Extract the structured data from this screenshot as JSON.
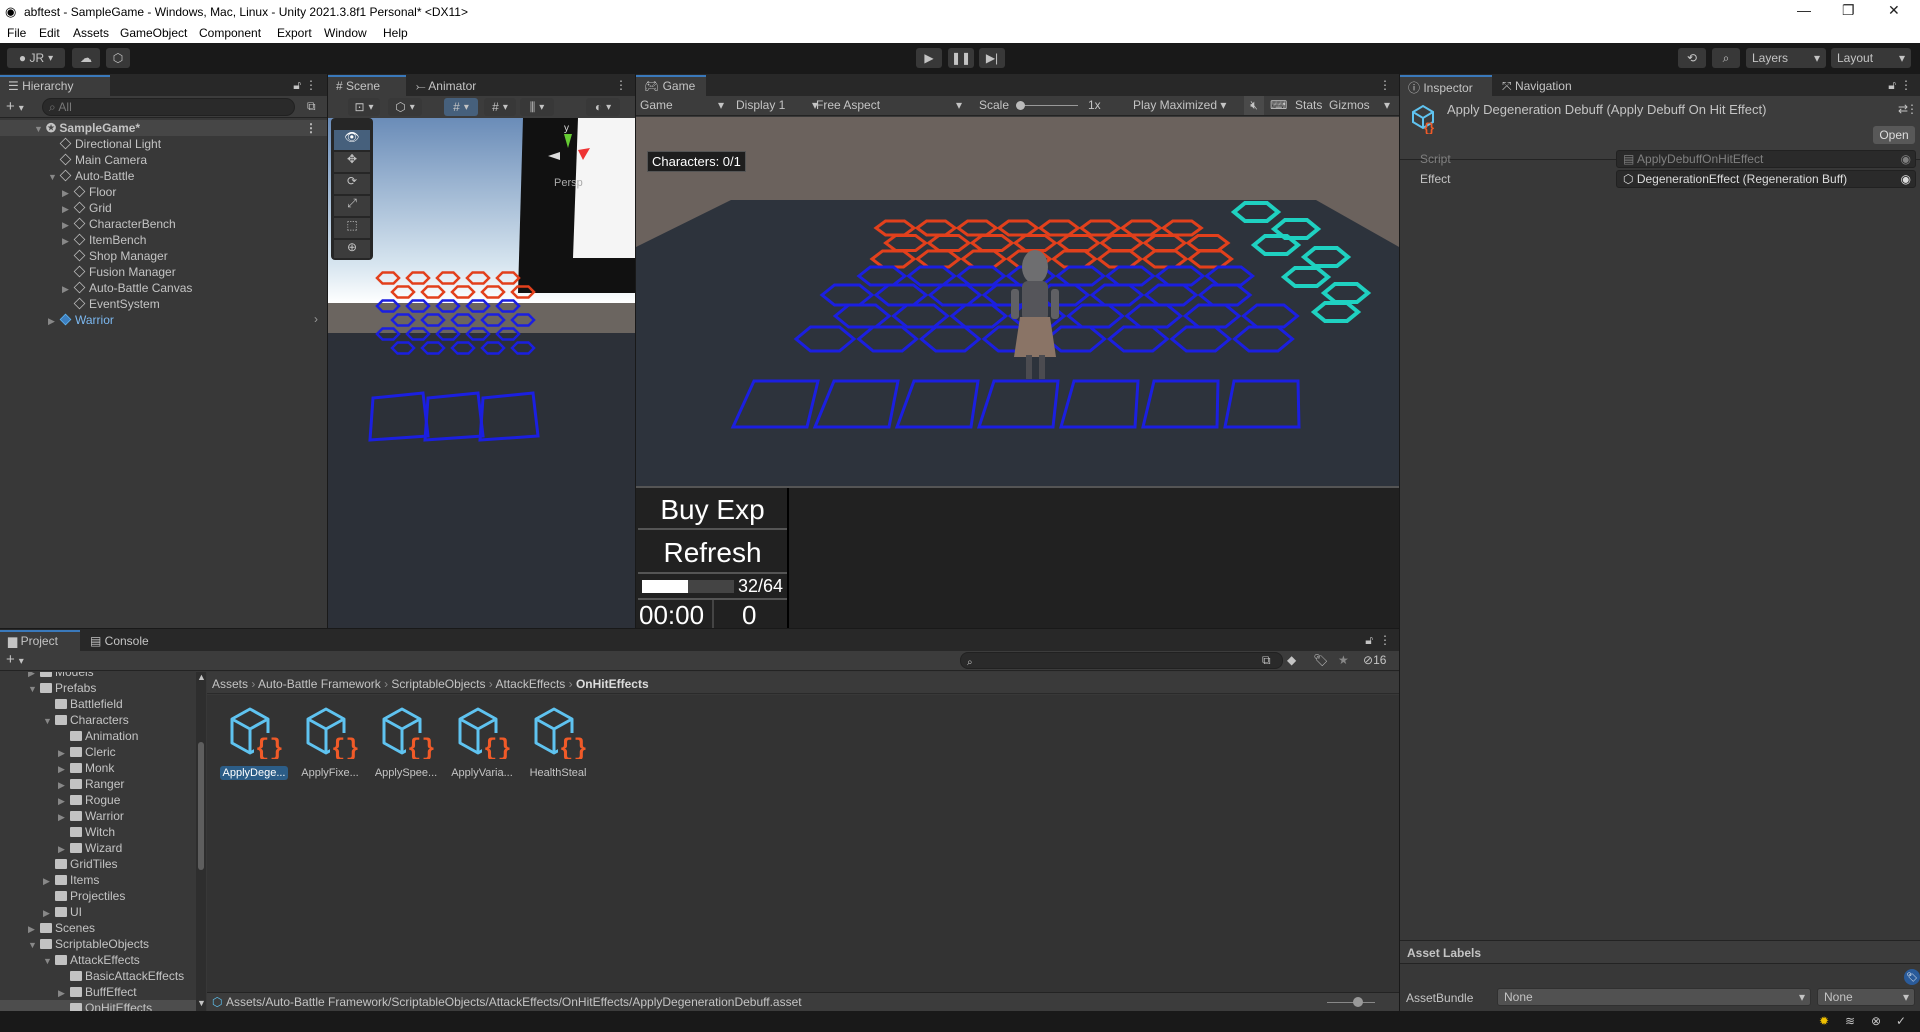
{
  "window": {
    "title": "abftest - SampleGame - Windows, Mac, Linux - Unity 2021.3.8f1 Personal* <DX11>",
    "minimize": "—",
    "maximize": "❐",
    "close": "✕"
  },
  "menu": [
    "File",
    "Edit",
    "Assets",
    "GameObject",
    "Component",
    "Export",
    "Window",
    "Help"
  ],
  "toolbar": {
    "account": "JR",
    "layers": "Layers",
    "layout": "Layout",
    "play_icon": "play-icon",
    "pause_icon": "pause-icon",
    "step_icon": "step-icon"
  },
  "hierarchy": {
    "tab": "Hierarchy",
    "search_placeholder": "All",
    "scene": "SampleGame*",
    "items": [
      {
        "label": "Directional Light",
        "depth": 1,
        "expander": ""
      },
      {
        "label": "Main Camera",
        "depth": 1,
        "expander": ""
      },
      {
        "label": "Auto-Battle",
        "depth": 1,
        "expander": "▼"
      },
      {
        "label": "Floor",
        "depth": 2,
        "expander": "▶"
      },
      {
        "label": "Grid",
        "depth": 2,
        "expander": "▶"
      },
      {
        "label": "CharacterBench",
        "depth": 2,
        "expander": "▶"
      },
      {
        "label": "ItemBench",
        "depth": 2,
        "expander": "▶"
      },
      {
        "label": "Shop Manager",
        "depth": 2,
        "expander": ""
      },
      {
        "label": "Fusion Manager",
        "depth": 2,
        "expander": ""
      },
      {
        "label": "Auto-Battle Canvas",
        "depth": 2,
        "expander": "▶"
      },
      {
        "label": "EventSystem",
        "depth": 2,
        "expander": ""
      },
      {
        "label": "Warrior",
        "depth": 1,
        "expander": "▶",
        "prefab": true
      }
    ]
  },
  "scene": {
    "tabs": [
      "Scene",
      "Animator"
    ],
    "persp": "Persp",
    "gizmo_y": "y"
  },
  "game": {
    "tab": "Game",
    "mode": "Game",
    "display": "Display 1",
    "aspect": "Free Aspect",
    "scale_label": "Scale",
    "scale_value": "1x",
    "play_mode": "Play Maximized",
    "stats": "Stats",
    "gizmos": "Gizmos",
    "characters": "Characters: 0/1",
    "buy_exp": "Buy Exp",
    "refresh": "Refresh",
    "exp": "32/64",
    "exp_fraction": 0.5,
    "timer": "00:00",
    "gold": "0",
    "colors": {
      "red_tiles": "#e2401c",
      "blue_tiles": "#1b1fe0",
      "cyan_tiles": "#1fd1c1"
    }
  },
  "inspector": {
    "tabs": [
      "Inspector",
      "Navigation"
    ],
    "title": "Apply Degeneration Debuff (Apply Debuff On Hit Effect)",
    "open": "Open",
    "fields": [
      {
        "label": "Script",
        "value": "ApplyDebuffOnHitEffect"
      },
      {
        "label": "Effect",
        "value": "DegenerationEffect (Regeneration Buff)"
      }
    ],
    "asset_labels": "Asset Labels",
    "asset_bundle_label": "AssetBundle",
    "asset_bundle": "None",
    "asset_variant": "None"
  },
  "project": {
    "tabs": [
      "Project",
      "Console"
    ],
    "hidden_count": "16",
    "tree": [
      {
        "label": "Models",
        "depth": 2,
        "expander": "▶"
      },
      {
        "label": "Prefabs",
        "depth": 2,
        "expander": "▼",
        "open": true
      },
      {
        "label": "Battlefield",
        "depth": 3,
        "expander": ""
      },
      {
        "label": "Characters",
        "depth": 3,
        "expander": "▼",
        "open": true
      },
      {
        "label": "Animation",
        "depth": 4,
        "expander": ""
      },
      {
        "label": "Cleric",
        "depth": 4,
        "expander": "▶"
      },
      {
        "label": "Monk",
        "depth": 4,
        "expander": "▶"
      },
      {
        "label": "Ranger",
        "depth": 4,
        "expander": "▶"
      },
      {
        "label": "Rogue",
        "depth": 4,
        "expander": "▶"
      },
      {
        "label": "Warrior",
        "depth": 4,
        "expander": "▶"
      },
      {
        "label": "Witch",
        "depth": 4,
        "expander": ""
      },
      {
        "label": "Wizard",
        "depth": 4,
        "expander": "▶"
      },
      {
        "label": "GridTiles",
        "depth": 3,
        "expander": ""
      },
      {
        "label": "Items",
        "depth": 3,
        "expander": "▶"
      },
      {
        "label": "Projectiles",
        "depth": 3,
        "expander": ""
      },
      {
        "label": "UI",
        "depth": 3,
        "expander": "▶"
      },
      {
        "label": "Scenes",
        "depth": 2,
        "expander": "▶"
      },
      {
        "label": "ScriptableObjects",
        "depth": 2,
        "expander": "▼",
        "open": true
      },
      {
        "label": "AttackEffects",
        "depth": 3,
        "expander": "▼",
        "open": true
      },
      {
        "label": "BasicAttackEffects",
        "depth": 4,
        "expander": ""
      },
      {
        "label": "BuffEffect",
        "depth": 4,
        "expander": "▶"
      },
      {
        "label": "OnHitEffects",
        "depth": 4,
        "expander": "",
        "selected": true
      }
    ],
    "breadcrumb": [
      "Assets",
      "Auto-Battle Framework",
      "ScriptableObjects",
      "AttackEffects",
      "OnHitEffects"
    ],
    "assets": [
      "ApplyDege...",
      "ApplyFixe...",
      "ApplySpee...",
      "ApplyVaria...",
      "HealthSteal"
    ],
    "selected_path": "Assets/Auto-Battle Framework/ScriptableObjects/AttackEffects/OnHitEffects/ApplyDegenerationDebuff.asset"
  }
}
